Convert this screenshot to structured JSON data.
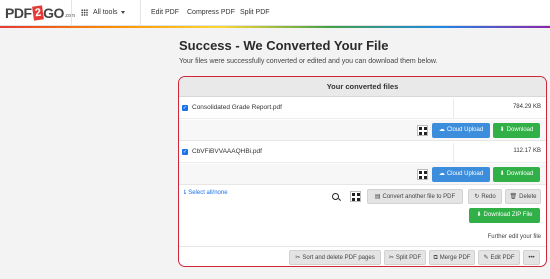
{
  "brand": {
    "logo_pdf": "PDF",
    "logo_two": "2",
    "logo_go": "GO",
    "logo_com": ".com"
  },
  "nav": {
    "all_tools": "All tools",
    "items": [
      "Edit PDF",
      "Compress PDF",
      "Split PDF"
    ]
  },
  "page": {
    "title": "Success - We Converted Your File",
    "subtitle": "Your files were successfully converted or edited and you can download them below."
  },
  "panel": {
    "header": "Your converted files",
    "files": [
      {
        "name": "Consolidated Grade Report.pdf",
        "size": "784.29 KB"
      },
      {
        "name": "CbVFiBVVAAAQHBi.pdf",
        "size": "112.17 KB"
      }
    ],
    "cloud_upload_label": "Cloud Upload",
    "download_label": "Download",
    "select_all_label": "Select all/none",
    "convert_another_label": "Convert another file to PDF",
    "redo_label": "Redo",
    "delete_label": "Delete",
    "download_zip_label": "Download ZIP File",
    "further_edit_label": "Further edit your file",
    "edit_tools": [
      "Sort and delete PDF pages",
      "Split PDF",
      "Merge PDF",
      "Edit PDF"
    ],
    "more_label": "•••"
  },
  "colors": {
    "accent_red": "#d0263a",
    "cloud_blue": "#3c8edc",
    "download_green": "#31b047"
  },
  "icons": [
    "apps-grid-icon",
    "chevron-down-icon",
    "checkbox-icon",
    "qr-code-icon",
    "cloud-upload-icon",
    "download-icon",
    "select-icon",
    "search-icon",
    "file-icon",
    "redo-icon",
    "trash-icon",
    "scissors-icon",
    "merge-icon",
    "edit-icon",
    "more-icon"
  ]
}
